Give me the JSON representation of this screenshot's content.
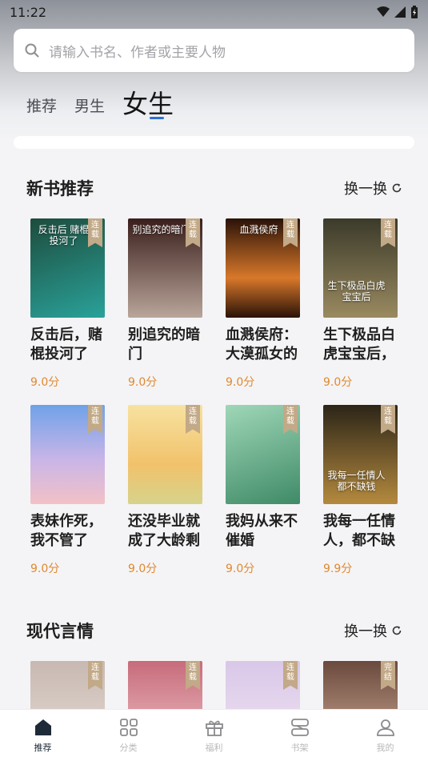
{
  "status_bar": {
    "time": "11:22"
  },
  "search": {
    "placeholder": "请输入书名、作者或主要人物"
  },
  "tabs": [
    {
      "label": "推荐",
      "active": false
    },
    {
      "label": "男生",
      "active": false
    },
    {
      "label": "女生",
      "active": true
    }
  ],
  "sections": [
    {
      "title": "新书推荐",
      "refresh_label": "换一换",
      "books": [
        {
          "title": "反击后，赌棍投河了",
          "cover_text": "反击后 赌棍投河了",
          "ribbon": "连载",
          "score": "9.0分",
          "colors": [
            "#1d4c3d",
            "#2aa29a"
          ]
        },
        {
          "title": "别追究的暗门",
          "cover_text": "别追究的暗门",
          "ribbon": "连载",
          "score": "9.0分",
          "colors": [
            "#3a1e1b",
            "#b9a59a"
          ]
        },
        {
          "title": "血溅侯府：大漠孤女的",
          "cover_text": "血溅侯府",
          "ribbon": "连载",
          "score": "9.0分",
          "colors": [
            "#2a1208",
            "#d8782a"
          ]
        },
        {
          "title": "生下极品白虎宝宝后，",
          "cover_text": "生下极品白虎宝宝后",
          "ribbon": "连载",
          "score": "9.0分",
          "colors": [
            "#3b3a2a",
            "#9a8a60"
          ]
        }
      ]
    },
    {
      "books": [
        {
          "title": "表妹作死，我不管了",
          "ribbon": "连载",
          "score": "9.0分",
          "colors": [
            "#6fa2e8",
            "#f3c1c6"
          ]
        },
        {
          "title": "还没毕业就成了大龄剩",
          "ribbon": "连载",
          "score": "9.0分",
          "colors": [
            "#f7e2a0",
            "#f1c26b"
          ]
        },
        {
          "title": "我妈从来不催婚",
          "ribbon": "连载",
          "score": "9.0分",
          "colors": [
            "#9fd7b8",
            "#3f8a67"
          ]
        },
        {
          "title": "我每一任情人，都不缺",
          "cover_text": "我每一任情人都不缺钱",
          "ribbon": "连载",
          "score": "9.9分",
          "colors": [
            "#2c2518",
            "#b58a3e"
          ]
        }
      ]
    },
    {
      "title": "现代言情",
      "refresh_label": "换一换",
      "books": [
        {
          "ribbon": "连载",
          "colors": [
            "#c7b9b2",
            "#e9dcd6"
          ]
        },
        {
          "ribbon": "连载",
          "colors": [
            "#c76b7b",
            "#f0c9c9"
          ]
        },
        {
          "ribbon": "连载",
          "colors": [
            "#d9c7e8",
            "#f1e6f3"
          ]
        },
        {
          "ribbon": "完结",
          "colors": [
            "#6a4a3e",
            "#d7b19a"
          ]
        }
      ]
    }
  ],
  "bottom_nav": [
    {
      "label": "推荐",
      "icon": "home-icon",
      "active": true
    },
    {
      "label": "分类",
      "icon": "grid-icon",
      "active": false
    },
    {
      "label": "福利",
      "icon": "gift-icon",
      "active": false
    },
    {
      "label": "书架",
      "icon": "bookshelf-icon",
      "active": false
    },
    {
      "label": "我的",
      "icon": "profile-icon",
      "active": false
    }
  ]
}
